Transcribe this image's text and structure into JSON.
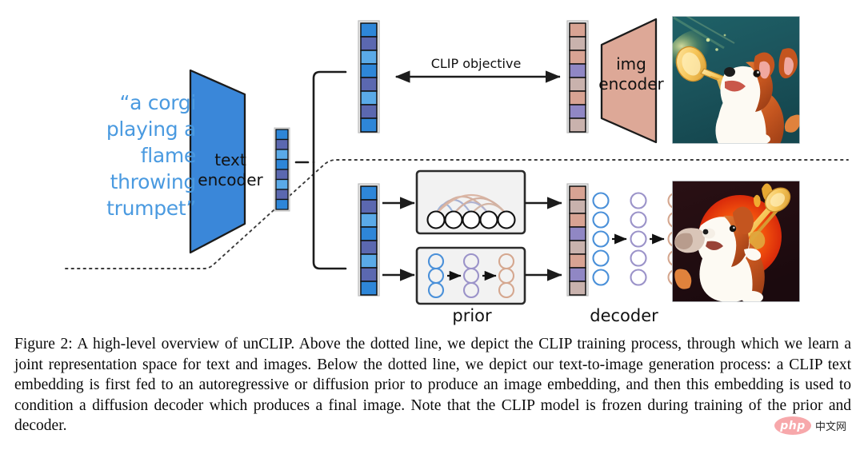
{
  "figure": {
    "prompt": "“a corgi playing a flame throwing trumpet”",
    "text_encoder_label_line1": "text",
    "text_encoder_label_line2": "encoder",
    "img_encoder_label_line1": "img",
    "img_encoder_label_line2": "encoder",
    "clip_objective_label": "CLIP objective",
    "prior_label": "prior",
    "decoder_label": "decoder",
    "images": {
      "top": "corgi-playing-trumpet-teal-background",
      "bottom": "corgi-playing-trombone-orange-sun-dark-background"
    },
    "icons": {
      "clip_arrow": "double-headed-arrow-icon",
      "branch_bracket": "curly-brace-bracket-icon",
      "flow_arrow": "right-arrow-icon",
      "dotted_separator": "dotted-divider-line"
    },
    "embeddings": {
      "text_embedding_small": {
        "name": "text-embedding-vector",
        "cells": 8,
        "colors": [
          "#2e86d8",
          "#5b68b0",
          "#5aaae8",
          "#2e86d8",
          "#5b68b0",
          "#5aaae8",
          "#5b68b0",
          "#2e86d8"
        ]
      },
      "text_embedding_top": {
        "name": "text-embedding-vector-clip",
        "cells": 8,
        "colors": [
          "#2e86d8",
          "#5b68b0",
          "#5aaae8",
          "#2e86d8",
          "#5b68b0",
          "#5aaae8",
          "#5b68b0",
          "#2e86d8"
        ]
      },
      "text_embedding_bottom": {
        "name": "text-embedding-vector-prior",
        "cells": 8,
        "colors": [
          "#2e86d8",
          "#5b68b0",
          "#5aaae8",
          "#2e86d8",
          "#5b68b0",
          "#5aaae8",
          "#5b68b0",
          "#2e86d8"
        ]
      },
      "image_embedding_top": {
        "name": "image-embedding-vector-clip",
        "cells": 8,
        "colors": [
          "#d8a393",
          "#c9b2ad",
          "#d8a393",
          "#9087c4",
          "#c9b2ad",
          "#d8a393",
          "#9087c4",
          "#c9b2ad"
        ]
      },
      "image_embedding_bottom": {
        "name": "image-embedding-vector-decoder",
        "cells": 8,
        "colors": [
          "#d8a393",
          "#c9b2ad",
          "#d8a393",
          "#9087c4",
          "#c9b2ad",
          "#d8a393",
          "#9087c4",
          "#c9b2ad"
        ]
      }
    },
    "colors": {
      "text_encoder_fill": "#3a87d9",
      "img_encoder_fill": "#dda897",
      "prompt_text": "#4a9ae0",
      "box_fill": "#f2f2f2",
      "box_stroke": "#2b2b2b",
      "circle_blue": "#4a90d9",
      "circle_purple": "#9b93c9",
      "circle_tan": "#d5a78f",
      "line": "#1c1c1c",
      "watermark_badge": "#f7a8ab"
    },
    "prior_autoregressive": {
      "name": "autoregressive-prior-box",
      "node_count": 5
    },
    "prior_diffusion": {
      "name": "diffusion-prior-box",
      "columns": 3,
      "rows": 3
    },
    "decoder_net": {
      "name": "decoder-network",
      "columns": 3,
      "rows": 5
    }
  },
  "caption": {
    "label": "Figure 2:",
    "text": " A high-level overview of unCLIP. Above the dotted line, we depict the CLIP training process, through which we learn a joint representation space for text and images. Below the dotted line, we depict our text-to-image generation process: a CLIP text embedding is first fed to an autoregressive or diffusion prior to produce an image embedding, and then this embedding is used to condition a diffusion decoder which produces a final image. Note that the CLIP model is frozen during training of the prior and decoder."
  },
  "watermark": {
    "badge": "php",
    "text": "中文网"
  }
}
